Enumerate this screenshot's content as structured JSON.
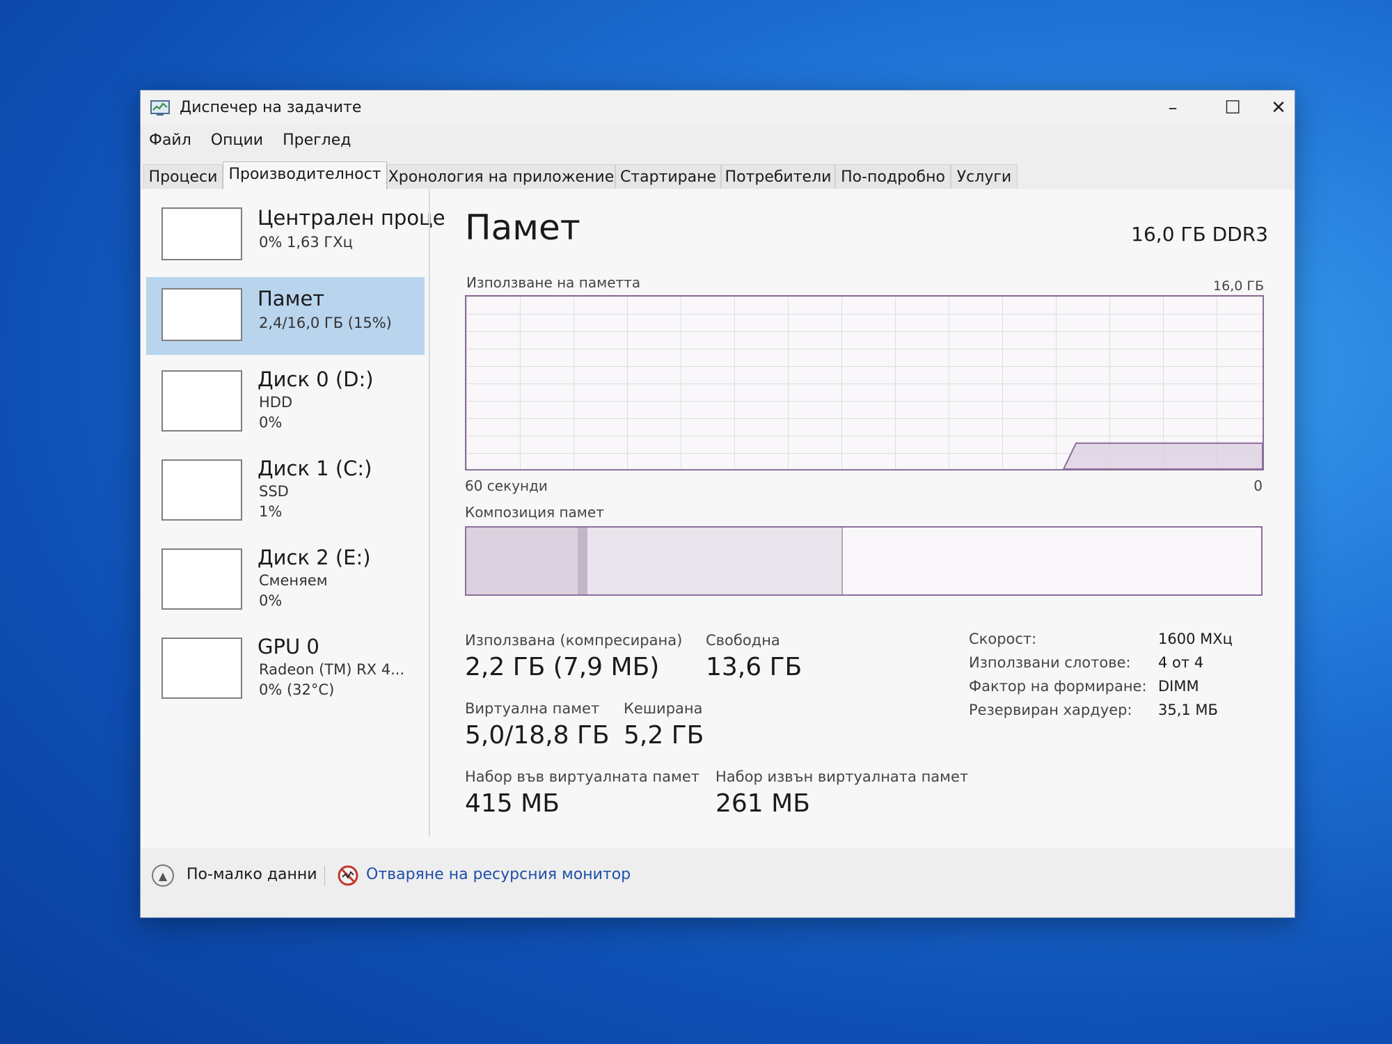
{
  "window": {
    "title": "Диспечер на задачите",
    "controls": {
      "minimize": "–",
      "maximize": "☐",
      "close": "✕"
    }
  },
  "menu": [
    "Файл",
    "Опции",
    "Преглед"
  ],
  "tabs": [
    "Процеси",
    "Производителност",
    "Хронология на приложение",
    "Стартиране",
    "Потребители",
    "По-подробно",
    "Услуги"
  ],
  "active_tab": "Производителност",
  "sidebar": [
    {
      "name": "Централен проце",
      "lines": [
        "0%  1,63 ГХц"
      ]
    },
    {
      "name": "Памет",
      "lines": [
        "2,4/16,0 ГБ (15%)"
      ],
      "selected": true
    },
    {
      "name": "Диск 0 (D:)",
      "lines": [
        "HDD",
        "0%"
      ]
    },
    {
      "name": "Диск 1 (C:)",
      "lines": [
        "SSD",
        "1%"
      ]
    },
    {
      "name": "Диск 2 (E:)",
      "lines": [
        "Сменяем",
        "0%"
      ]
    },
    {
      "name": "GPU 0",
      "lines": [
        "Radeon (TM) RX 4...",
        "0% (32°C)"
      ]
    }
  ],
  "main": {
    "heading": "Памет",
    "mem_type": "16,0 ГБ DDR3",
    "usage_label": "Използване на паметта",
    "usage_max": "16,0 ГБ",
    "time_left": "60 секунди",
    "time_right": "0",
    "composition_label": "Композиция памет",
    "used_fraction": 0.15,
    "composition": {
      "in_use": 0.14,
      "modified": 0.012,
      "standby": 0.322
    },
    "stats": {
      "used_label": "Използвана (компресирана)",
      "used_value": "2,2 ГБ (7,9 МБ)",
      "free_label": "Свободна",
      "free_value": "13,6 ГБ",
      "virtual_label": "Виртуална памет",
      "virtual_value": "5,0/18,8 ГБ",
      "cached_label": "Кеширана",
      "cached_value": "5,2 ГБ",
      "paged_label": "Набор във виртуалната памет",
      "paged_value": "415 МБ",
      "nonpaged_label": "Набор извън виртуалната памет",
      "nonpaged_value": "261 МБ"
    },
    "details": [
      {
        "label": "Скорост:",
        "value": "1600 MXц"
      },
      {
        "label": "Използвани слотове:",
        "value": "4 от 4"
      },
      {
        "label": "Фактор на формиране:",
        "value": "DIMM"
      },
      {
        "label": "Резервиран хардуер:",
        "value": "35,1 МБ"
      }
    ]
  },
  "footer": {
    "fewer_details": "По-малко данни",
    "resource_monitor": "Отваряне на ресурсния монитор"
  }
}
